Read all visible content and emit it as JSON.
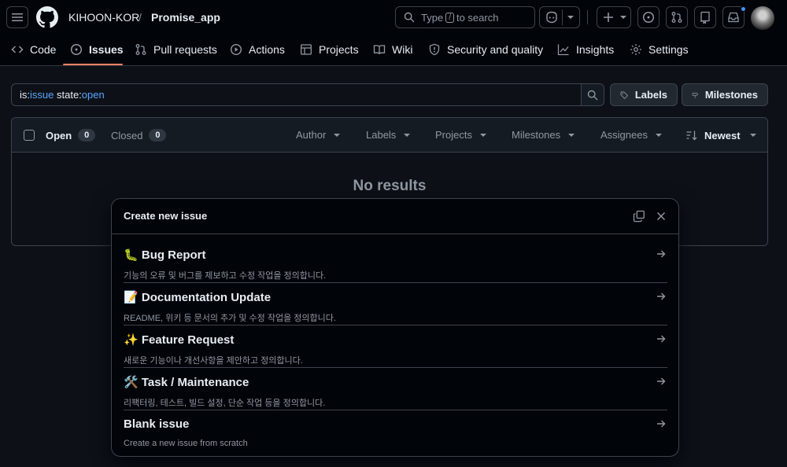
{
  "header": {
    "owner": "KIHOON-KOR",
    "separator": "/",
    "repo": "Promise_app",
    "search_prefix": "Type",
    "search_key": "/",
    "search_suffix": "to search"
  },
  "nav": {
    "items": [
      {
        "label": "Code",
        "icon": "code-icon"
      },
      {
        "label": "Issues",
        "icon": "issue-opened-icon"
      },
      {
        "label": "Pull requests",
        "icon": "pull-request-icon"
      },
      {
        "label": "Actions",
        "icon": "play-icon"
      },
      {
        "label": "Projects",
        "icon": "table-icon"
      },
      {
        "label": "Wiki",
        "icon": "book-icon"
      },
      {
        "label": "Security and quality",
        "icon": "shield-icon"
      },
      {
        "label": "Insights",
        "icon": "graph-icon"
      },
      {
        "label": "Settings",
        "icon": "gear-icon"
      }
    ],
    "active": "Issues"
  },
  "filter": {
    "k1": "is:",
    "v1": "issue",
    "k2": "state:",
    "v2": "open",
    "labels_button": "Labels",
    "milestones_button": "Milestones"
  },
  "list": {
    "open_label": "Open",
    "open_count": "0",
    "closed_label": "Closed",
    "closed_count": "0",
    "filters": [
      "Author",
      "Labels",
      "Projects",
      "Milestones",
      "Assignees"
    ],
    "sort_label": "Newest",
    "empty_text": "No results"
  },
  "dialog": {
    "title": "Create new issue",
    "templates": [
      {
        "emoji": "🐛",
        "name": "Bug Report",
        "description": "기능의 오류 및 버그를 제보하고 수정 작업을 정의합니다."
      },
      {
        "emoji": "📝",
        "name": "Documentation Update",
        "description": "README, 위키 등 문서의 추가 및 수정 작업을 정의합니다."
      },
      {
        "emoji": "✨",
        "name": "Feature Request",
        "description": "새로운 기능이나 개선사항을 제안하고 정의합니다."
      },
      {
        "emoji": "🛠️",
        "name": "Task / Maintenance",
        "description": "리팩터링, 테스트, 빌드 설정, 단순 작업 등을 정의합니다."
      },
      {
        "emoji": "",
        "name": "Blank issue",
        "description": "Create a new issue from scratch"
      }
    ]
  },
  "colors": {
    "background": "#0d1117",
    "header": "#010409",
    "accent_underline": "#f78166",
    "link_blue": "#58a6ff",
    "notification_dot": "#4493f8"
  }
}
